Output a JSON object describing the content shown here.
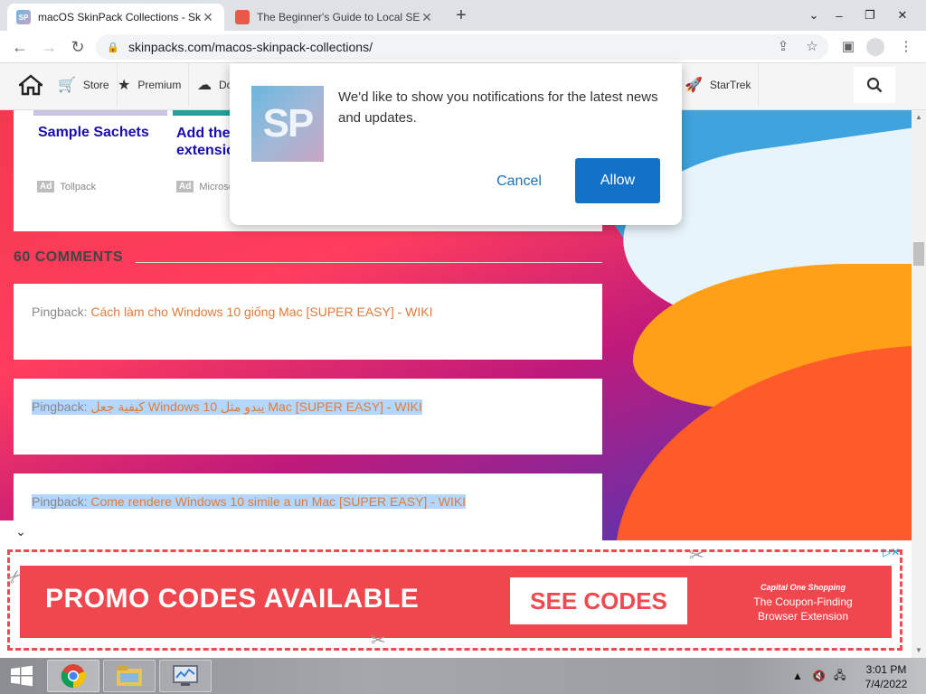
{
  "tabs": [
    {
      "title": "macOS SkinPack Collections - Sk",
      "favicon": "SP"
    },
    {
      "title": "The Beginner's Guide to Local SE"
    }
  ],
  "address": {
    "url": "skinpacks.com/macos-skinpack-collections/"
  },
  "site_nav": {
    "items": [
      {
        "label": "Store",
        "icon": "cart-icon"
      },
      {
        "label": "Premium",
        "icon": "star-icon"
      },
      {
        "label": "Do",
        "icon": "cloud-icon"
      },
      {
        "label": "StarTrek",
        "icon": "rocket-icon"
      }
    ]
  },
  "ads": [
    {
      "title": "Sample Sachets",
      "source": "Tollpack",
      "tag": "Ad"
    },
    {
      "title_line1": "Add the",
      "title_line2": "extensio",
      "source": "Microso",
      "tag": "Ad"
    }
  ],
  "comments": {
    "heading": "60 COMMENTS",
    "items": [
      {
        "prefix": "Pingback:",
        "link": "Cách làm cho Windows 10 giống Mac [SUPER EASY] - WIKI"
      },
      {
        "prefix": "Pingback:",
        "link": "كيفية جعل Windows 10 يبدو مثل Mac [SUPER EASY] - WIKI"
      },
      {
        "prefix": "Pingback:",
        "link": "Come rendere Windows 10 simile a un Mac [SUPER EASY] - WIKI"
      }
    ]
  },
  "notification": {
    "logo": "SP",
    "message": "We'd like to show you notifications for the latest news and updates.",
    "cancel": "Cancel",
    "allow": "Allow"
  },
  "banner": {
    "headline": "PROMO CODES AVAILABLE",
    "cta": "SEE CODES",
    "brand": "Capital One Shopping",
    "tagline_line1": "The Coupon-Finding",
    "tagline_line2": "Browser Extension"
  },
  "taskbar": {
    "time": "3:01 PM",
    "date": "7/4/2022"
  },
  "colors": {
    "link": "#e07b39",
    "allow_button": "#1372c8",
    "banner_red": "#f0474f"
  }
}
